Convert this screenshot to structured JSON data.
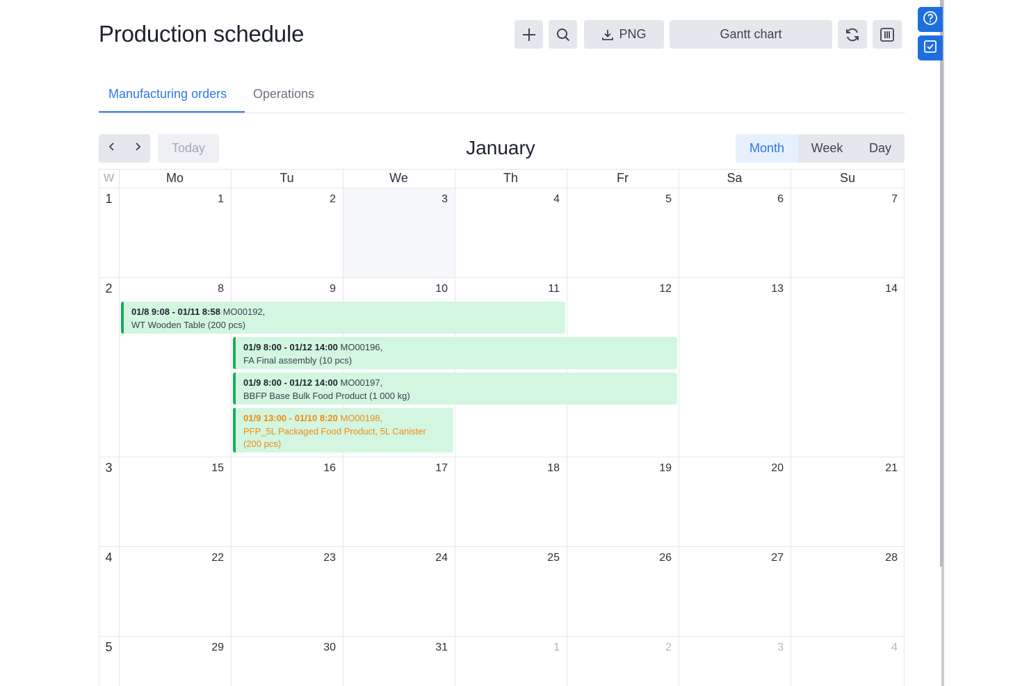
{
  "header": {
    "title": "Production schedule",
    "png_label": "PNG",
    "gantt_label": "Gantt chart"
  },
  "tabs": [
    {
      "label": "Manufacturing orders",
      "active": true
    },
    {
      "label": "Operations",
      "active": false
    }
  ],
  "nav": {
    "today_label": "Today",
    "month_title": "January",
    "views": [
      {
        "label": "Month",
        "active": true
      },
      {
        "label": "Week",
        "active": false
      },
      {
        "label": "Day",
        "active": false
      }
    ]
  },
  "calendar": {
    "week_header": "W",
    "day_headers": [
      "Mo",
      "Tu",
      "We",
      "Th",
      "Fr",
      "Sa",
      "Su"
    ],
    "weeks": [
      {
        "week": "1",
        "days": [
          "1",
          "2",
          "3",
          "4",
          "5",
          "6",
          "7"
        ]
      },
      {
        "week": "2",
        "days": [
          "8",
          "9",
          "10",
          "11",
          "12",
          "13",
          "14"
        ]
      },
      {
        "week": "3",
        "days": [
          "15",
          "16",
          "17",
          "18",
          "19",
          "20",
          "21"
        ]
      },
      {
        "week": "4",
        "days": [
          "22",
          "23",
          "24",
          "25",
          "26",
          "27",
          "28"
        ]
      },
      {
        "week": "5",
        "days": [
          "29",
          "30",
          "31",
          "1",
          "2",
          "3",
          "4"
        ]
      }
    ],
    "today": "3",
    "events": [
      {
        "time": "01/8 9:08 - 01/11 8:58",
        "ref": "MO00192,",
        "desc": "WT Wooden Table (200 pcs)"
      },
      {
        "time": "01/9 8:00 - 01/12 14:00",
        "ref": "MO00196,",
        "desc": "FA Final assembly (10 pcs)"
      },
      {
        "time": "01/9 8:00 - 01/12 14:00",
        "ref": "MO00197,",
        "desc": "BBFP Base Bulk Food Product (1 000 kg)"
      },
      {
        "time": "01/9 13:00 - 01/10 8:20",
        "ref": "MO00198,",
        "desc": "PFP_5L Packaged Food Product, 5L Canister",
        "desc2": "(200 pcs)"
      }
    ]
  },
  "colors": {
    "accent": "#2c78e6",
    "event_bg": "#d2f6df",
    "event_border": "#1aad5c",
    "event_warning": "#f08a12",
    "side_button": "#1d6fe0"
  },
  "icons": [
    "plus-icon",
    "search-icon",
    "download-icon",
    "refresh-icon",
    "columns-icon",
    "chevron-left-icon",
    "chevron-right-icon",
    "help-icon",
    "checkbox-icon"
  ]
}
